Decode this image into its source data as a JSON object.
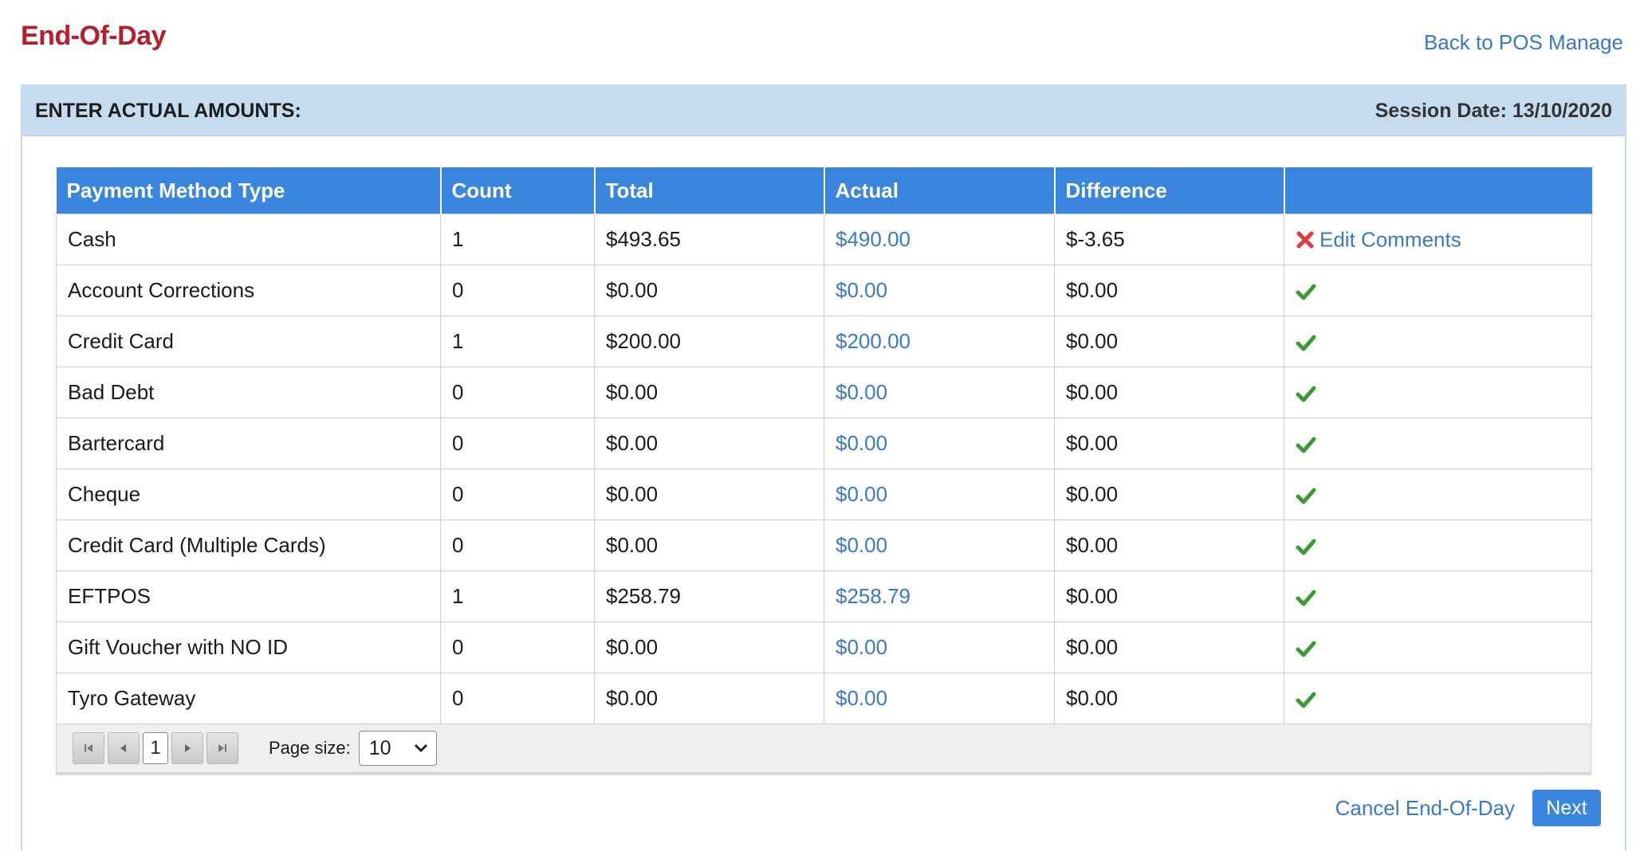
{
  "page": {
    "title": "End-Of-Day",
    "back_link": "Back to POS Manage"
  },
  "panel": {
    "heading": "ENTER ACTUAL AMOUNTS:",
    "session_date": "Session Date: 13/10/2020"
  },
  "grid": {
    "columns": [
      "Payment Method Type",
      "Count",
      "Total",
      "Actual",
      "Difference",
      ""
    ],
    "rows": [
      {
        "method": "Cash",
        "count": "1",
        "total": "$493.65",
        "actual": "$490.00",
        "difference": "$-3.65",
        "status": "error",
        "comment_link": "Edit Comments"
      },
      {
        "method": "Account Corrections",
        "count": "0",
        "total": "$0.00",
        "actual": "$0.00",
        "difference": "$0.00",
        "status": "ok"
      },
      {
        "method": "Credit Card",
        "count": "1",
        "total": "$200.00",
        "actual": "$200.00",
        "difference": "$0.00",
        "status": "ok"
      },
      {
        "method": "Bad Debt",
        "count": "0",
        "total": "$0.00",
        "actual": "$0.00",
        "difference": "$0.00",
        "status": "ok"
      },
      {
        "method": "Bartercard",
        "count": "0",
        "total": "$0.00",
        "actual": "$0.00",
        "difference": "$0.00",
        "status": "ok"
      },
      {
        "method": "Cheque",
        "count": "0",
        "total": "$0.00",
        "actual": "$0.00",
        "difference": "$0.00",
        "status": "ok"
      },
      {
        "method": "Credit Card (Multiple Cards)",
        "count": "0",
        "total": "$0.00",
        "actual": "$0.00",
        "difference": "$0.00",
        "status": "ok"
      },
      {
        "method": "EFTPOS",
        "count": "1",
        "total": "$258.79",
        "actual": "$258.79",
        "difference": "$0.00",
        "status": "ok"
      },
      {
        "method": "Gift Voucher with NO ID",
        "count": "0",
        "total": "$0.00",
        "actual": "$0.00",
        "difference": "$0.00",
        "status": "ok"
      },
      {
        "method": "Tyro Gateway",
        "count": "0",
        "total": "$0.00",
        "actual": "$0.00",
        "difference": "$0.00",
        "status": "ok"
      }
    ]
  },
  "pager": {
    "current_page": "1",
    "page_size_label": "Page size:",
    "page_size": "10"
  },
  "footer": {
    "cancel_label": "Cancel End-Of-Day",
    "next_label": "Next"
  },
  "colors": {
    "title": "#b5202e",
    "link": "#3a78c9",
    "header_bg": "#3a86de",
    "panel_head_bg": "#c5dbee",
    "ok_check": "#3a9a3a",
    "error_x": "#e0393e"
  },
  "icons": {
    "ok": "check-icon",
    "error": "red-x-icon",
    "first_page": "first-page-icon",
    "prev_page": "prev-page-icon",
    "next_page": "next-page-icon",
    "last_page": "last-page-icon",
    "dropdown": "chevron-down-icon"
  }
}
